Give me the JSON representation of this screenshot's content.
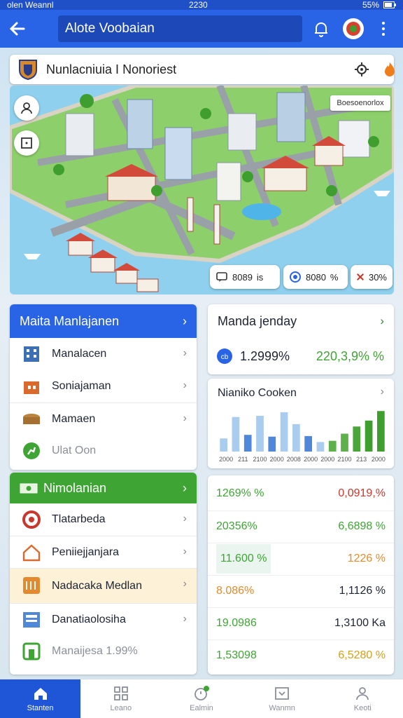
{
  "status": {
    "left": "olen Weannl",
    "time": "2230",
    "battery": "55%"
  },
  "header": {
    "title": "Alote Voobaian"
  },
  "location": {
    "title": "Nunlacniuia I Nonoriest"
  },
  "map": {
    "label": "Boesoenorlox",
    "pills": [
      {
        "value": "8089",
        "unit": "is"
      },
      {
        "value": "8080",
        "unit": "%"
      },
      {
        "value": "30%",
        "unit": ""
      }
    ]
  },
  "menu1": {
    "header": "Maita Manlajanen",
    "items": [
      {
        "label": "Manalacen"
      },
      {
        "label": "Soniajaman"
      },
      {
        "label": "Mamaen"
      },
      {
        "label": "Ulat Oon"
      }
    ]
  },
  "menu2": {
    "header": "Nimolanian",
    "items": [
      {
        "label": "Tlatarbeda"
      },
      {
        "label": "Peniiejjanjara"
      },
      {
        "label": "Nadacaka Medlan"
      },
      {
        "label": "Danatiaolosiha"
      },
      {
        "label": "Manaijesa 1.99%"
      }
    ]
  },
  "summary": {
    "title": "Manda jenday",
    "left_value": "1.2999%",
    "right_value": "220,3,9% %"
  },
  "chart_panel": {
    "title": "Nianiko Cooken"
  },
  "chart_data": {
    "type": "bar",
    "categories": [
      "2000",
      "211",
      "2100",
      "2000",
      "2008",
      "2000",
      "2000",
      "2100",
      "213",
      "2000"
    ],
    "series": [
      {
        "values": [
          22,
          58,
          28,
          60,
          25,
          66,
          46,
          26,
          16,
          18,
          30,
          42,
          52,
          68
        ]
      }
    ],
    "colors": [
      "#a9ccef",
      "#a9ccef",
      "#4f87d9",
      "#a9ccef",
      "#4f87d9",
      "#a9ccef",
      "#a9ccef",
      "#4f87d9",
      "#a9ccef",
      "#5db04a",
      "#5db04a",
      "#4aa63a",
      "#3e9e2e",
      "#3e9e2e"
    ],
    "ylim": [
      0,
      80
    ]
  },
  "stats": [
    {
      "left": "1269% %",
      "right": "0,0919,%"
    },
    {
      "left": "20356%",
      "right": "6,6898 %"
    },
    {
      "left": "11.600 %",
      "right": "1226 %"
    },
    {
      "left": "8.086%",
      "right": "1,1126 %"
    },
    {
      "left": "19.0986",
      "right": "1,3100 Ka"
    },
    {
      "left": "1,53098",
      "right": "6,5280 %"
    }
  ],
  "nav": [
    {
      "label": "Stanten"
    },
    {
      "label": "Leano"
    },
    {
      "label": "Ealmin"
    },
    {
      "label": "Wanmn"
    },
    {
      "label": "Keoti"
    }
  ],
  "colors": {
    "primary": "#2a64e6",
    "green": "#3ea534",
    "red": "#c8382e"
  }
}
